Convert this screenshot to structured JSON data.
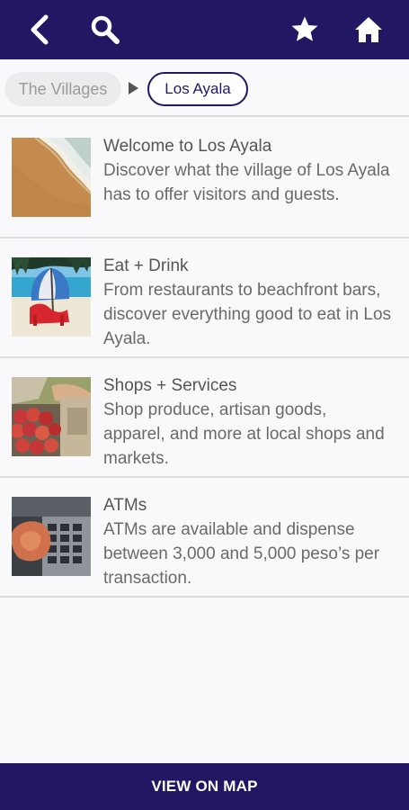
{
  "header": {
    "back_icon": "chevron-left-icon",
    "search_icon": "search-icon",
    "favorite_icon": "star-icon",
    "home_icon": "home-icon",
    "bg_color": "#221763"
  },
  "breadcrumbs": {
    "parent_label": "The Villages",
    "current_label": "Los Ayala"
  },
  "items": [
    {
      "title": "Welcome to Los Ayala",
      "description": "Discover what the village of Los Ayala has to offer visitors and guests."
    },
    {
      "title": "Eat + Drink",
      "description": "From restaurants to beachfront bars, discover everything good to eat in Los Ayala."
    },
    {
      "title": "Shops + Services",
      "description": "Shop produce, artisan goods, apparel, and more at local shops and markets."
    },
    {
      "title": "ATMs",
      "description": "ATMs are available and dispense between 3,000 and 5,000 peso’s per transaction."
    }
  ],
  "footer": {
    "map_button_label": "VIEW ON MAP"
  }
}
